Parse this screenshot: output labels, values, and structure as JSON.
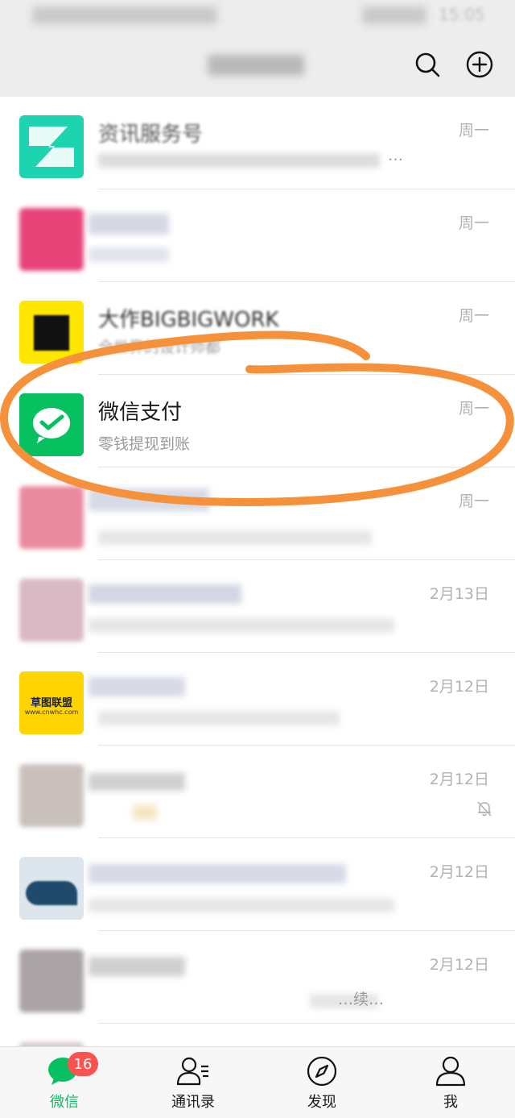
{
  "status_bar": {
    "time": "15:05"
  },
  "header": {
    "search_icon": "search-icon",
    "add_icon": "plus-circle-icon"
  },
  "chats": [
    {
      "name": "资讯服务号",
      "preview": "…",
      "time": "周一"
    },
    {
      "name": "",
      "preview": "",
      "time": "周一"
    },
    {
      "name": "大作BIGBIGWORK",
      "preview": "全世界的设计师都",
      "time": "周一"
    },
    {
      "name": "微信支付",
      "preview": "零钱提现到账",
      "time": "周一"
    },
    {
      "name": "",
      "preview": "",
      "time": "周一"
    },
    {
      "name": "",
      "preview": "",
      "time": "2月13日"
    },
    {
      "name": "",
      "preview": "",
      "time": "2月12日",
      "avatar_text": "草图联盟",
      "avatar_sub": "www.cnwhc.com"
    },
    {
      "name": "",
      "preview": "",
      "time": "2月12日",
      "muted_icon": "bell-off-icon"
    },
    {
      "name": "",
      "preview": "",
      "time": "2月12日"
    },
    {
      "name": "",
      "preview": "…续…",
      "time": "2月12日"
    }
  ],
  "tabs": [
    {
      "label": "微信",
      "icon": "chat-bubble-icon",
      "badge": "16",
      "active": true
    },
    {
      "label": "通讯录",
      "icon": "contacts-icon"
    },
    {
      "label": "发现",
      "icon": "compass-icon"
    },
    {
      "label": "我",
      "icon": "person-icon"
    }
  ],
  "colors": {
    "wechat_green": "#07c160",
    "badge_red": "#fa5151",
    "annotation_orange": "#f5913a"
  }
}
